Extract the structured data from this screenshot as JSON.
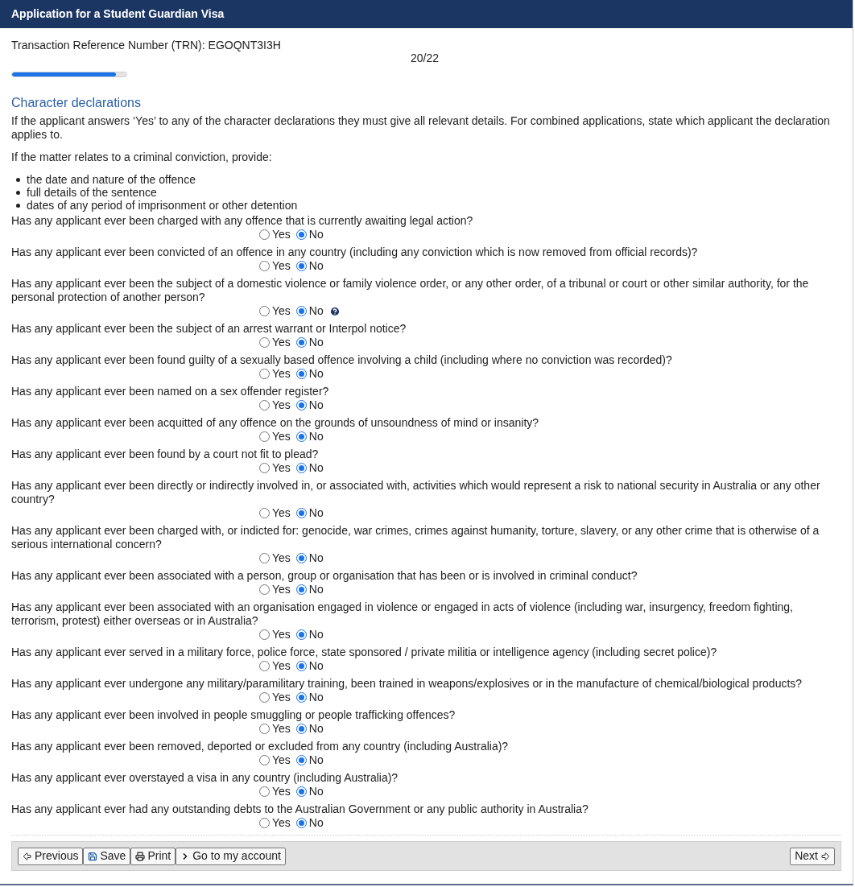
{
  "window": {
    "title": "Application for a Student Guardian Visa"
  },
  "trn": "Transaction Reference Number (TRN): EGOQNT3I3H",
  "progress": {
    "step": "20/22",
    "level": 0.91
  },
  "section": {
    "title": "Character declarations",
    "intro": "If the applicant answers ‘Yes’ to any of the character declarations they must give all relevant details. For combined applications, state which applicant the declaration applies to.",
    "conviction_intro": "If the matter relates to a criminal conviction, provide:",
    "bullets": [
      "the date and nature of the offence",
      "full details of the sentence",
      "dates of any period of imprisonment or other detention"
    ]
  },
  "questions": [
    {
      "text": "Has any applicant ever been charged with any offence that is currently awaiting legal action?",
      "options": [
        {
          "label": "Yes",
          "selected": false
        },
        {
          "label": "No",
          "selected": true
        }
      ],
      "help": false
    },
    {
      "text": "Has any applicant ever been convicted of an offence in any country (including any conviction which is now removed from official records)?",
      "options": [
        {
          "label": "Yes",
          "selected": false
        },
        {
          "label": "No",
          "selected": true
        }
      ],
      "help": false
    },
    {
      "text": "Has any applicant ever been the subject of a domestic violence or family violence order, or any other order, of a tribunal or court or other similar authority, for the personal protection of another person?",
      "options": [
        {
          "label": "Yes",
          "selected": false
        },
        {
          "label": "No",
          "selected": true
        }
      ],
      "help": true
    },
    {
      "text": "Has any applicant ever been the subject of an arrest warrant or Interpol notice?",
      "options": [
        {
          "label": "Yes",
          "selected": false
        },
        {
          "label": "No",
          "selected": true
        }
      ],
      "help": false
    },
    {
      "text": "Has any applicant ever been found guilty of a sexually based offence involving a child (including where no conviction was recorded)?",
      "options": [
        {
          "label": "Yes",
          "selected": false
        },
        {
          "label": "No",
          "selected": true
        }
      ],
      "help": false
    },
    {
      "text": "Has any applicant ever been named on a sex offender register?",
      "options": [
        {
          "label": "Yes",
          "selected": false
        },
        {
          "label": "No",
          "selected": true
        }
      ],
      "help": false
    },
    {
      "text": "Has any applicant ever been acquitted of any offence on the grounds of unsoundness of mind or insanity?",
      "options": [
        {
          "label": "Yes",
          "selected": false
        },
        {
          "label": "No",
          "selected": true
        }
      ],
      "help": false
    },
    {
      "text": "Has any applicant ever been found by a court not fit to plead?",
      "options": [
        {
          "label": "Yes",
          "selected": false
        },
        {
          "label": "No",
          "selected": true
        }
      ],
      "help": false
    },
    {
      "text": "Has any applicant ever been directly or indirectly involved in, or associated with, activities which would represent a risk to national security in Australia or any other country?",
      "options": [
        {
          "label": "Yes",
          "selected": false
        },
        {
          "label": "No",
          "selected": true
        }
      ],
      "help": false
    },
    {
      "text": "Has any applicant ever been charged with, or indicted for: genocide, war crimes, crimes against humanity, torture, slavery, or any other crime that is otherwise of a serious international concern?",
      "options": [
        {
          "label": "Yes",
          "selected": false
        },
        {
          "label": "No",
          "selected": true
        }
      ],
      "help": false
    },
    {
      "text": "Has any applicant ever been associated with a person, group or organisation that has been or is involved in criminal conduct?",
      "options": [
        {
          "label": "Yes",
          "selected": false
        },
        {
          "label": "No",
          "selected": true
        }
      ],
      "help": false
    },
    {
      "text": "Has any applicant ever been associated with an organisation engaged in violence or engaged in acts of violence (including war, insurgency, freedom fighting, terrorism, protest) either overseas or in Australia?",
      "options": [
        {
          "label": "Yes",
          "selected": false
        },
        {
          "label": "No",
          "selected": true
        }
      ],
      "help": false
    },
    {
      "text": "Has any applicant ever served in a military force, police force, state sponsored / private militia or intelligence agency (including secret police)?",
      "options": [
        {
          "label": "Yes",
          "selected": false
        },
        {
          "label": "No",
          "selected": true
        }
      ],
      "help": false
    },
    {
      "text": "Has any applicant ever undergone any military/paramilitary training, been trained in weapons/explosives or in the manufacture of chemical/biological products?",
      "options": [
        {
          "label": "Yes",
          "selected": false
        },
        {
          "label": "No",
          "selected": true
        }
      ],
      "help": false
    },
    {
      "text": "Has any applicant ever been involved in people smuggling or people trafficking offences?",
      "options": [
        {
          "label": "Yes",
          "selected": false
        },
        {
          "label": "No",
          "selected": true
        }
      ],
      "help": false
    },
    {
      "text": "Has any applicant ever been removed, deported or excluded from any country (including Australia)?",
      "options": [
        {
          "label": "Yes",
          "selected": false
        },
        {
          "label": "No",
          "selected": true
        }
      ],
      "help": false
    },
    {
      "text": "Has any applicant ever overstayed a visa in any country (including Australia)?",
      "options": [
        {
          "label": "Yes",
          "selected": false
        },
        {
          "label": "No",
          "selected": true
        }
      ],
      "help": false
    },
    {
      "text": "Has any applicant ever had any outstanding debts to the Australian Government or any public authority in Australia?",
      "options": [
        {
          "label": "Yes",
          "selected": false
        },
        {
          "label": "No",
          "selected": true
        }
      ],
      "help": false
    }
  ],
  "buttons": [
    {
      "label": "Previous",
      "kind": "previous"
    },
    {
      "label": "Save",
      "kind": "save"
    },
    {
      "label": "Print",
      "kind": "print"
    },
    {
      "label": "Go to my account",
      "kind": "account"
    }
  ],
  "next_button": {
    "label": "Next",
    "kind": "next"
  }
}
